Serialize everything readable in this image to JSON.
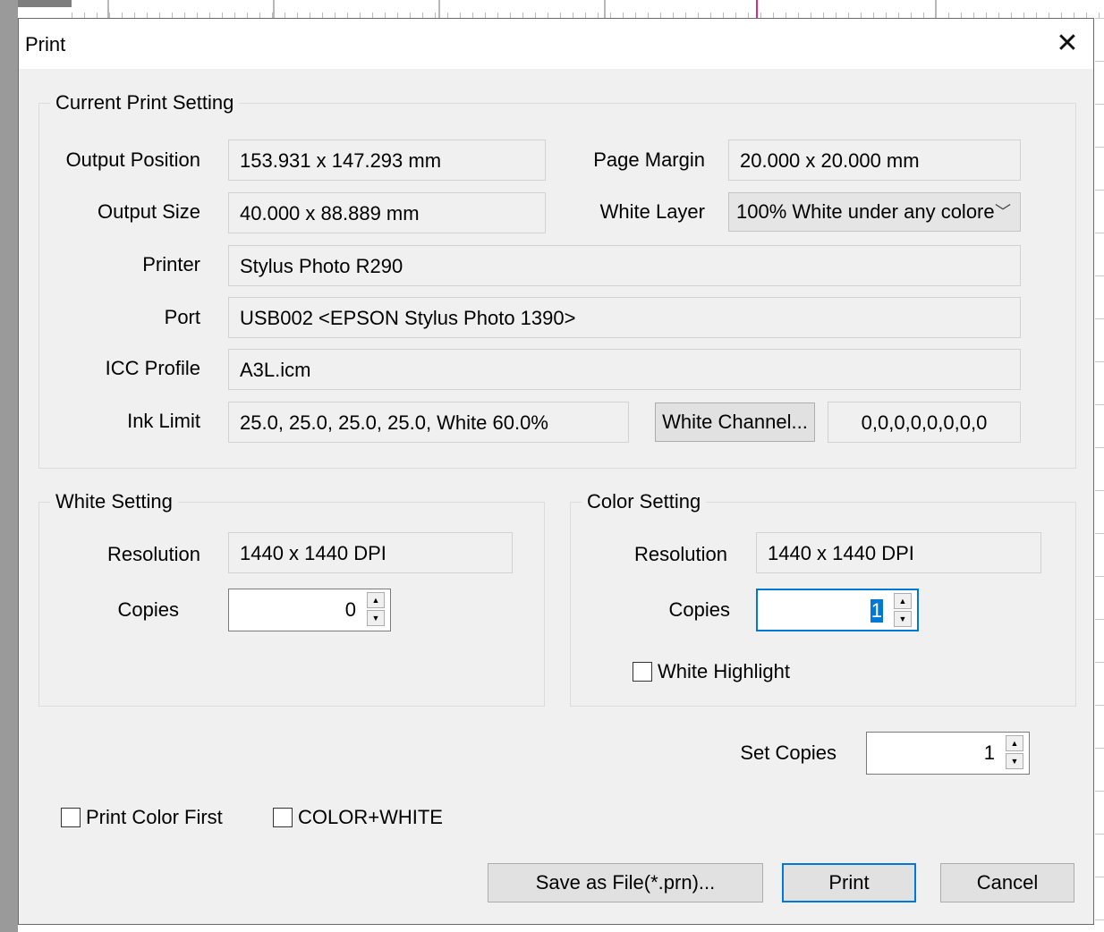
{
  "dialog": {
    "title": "Print",
    "close_symbol": "✕"
  },
  "current": {
    "legend": "Current Print Setting",
    "output_position_label": "Output Position",
    "output_position_value": "153.931 x 147.293 mm",
    "page_margin_label": "Page Margin",
    "page_margin_value": "20.000 x 20.000 mm",
    "output_size_label": "Output Size",
    "output_size_value": "40.000 x 88.889 mm",
    "white_layer_label": "White Layer",
    "white_layer_value": "100% White under any colore",
    "printer_label": "Printer",
    "printer_value": "Stylus Photo R290",
    "port_label": "Port",
    "port_value": "USB002  <EPSON Stylus Photo 1390>",
    "icc_label": "ICC Profile",
    "icc_value": "A3L.icm",
    "ink_limit_label": "Ink Limit",
    "ink_limit_value": "25.0, 25.0, 25.0, 25.0, White 60.0%",
    "white_channel_button": "White Channel...",
    "white_channel_value": "0,0,0,0,0,0,0,0"
  },
  "white_setting": {
    "legend": "White Setting",
    "resolution_label": "Resolution",
    "resolution_value": "1440 x 1440 DPI",
    "copies_label": "Copies",
    "copies_value": "0"
  },
  "color_setting": {
    "legend": "Color Setting",
    "resolution_label": "Resolution",
    "resolution_value": "1440 x 1440 DPI",
    "copies_label": "Copies",
    "copies_value": "1",
    "white_highlight_label": "White Highlight"
  },
  "set_copies": {
    "label": "Set Copies",
    "value": "1"
  },
  "options": {
    "print_color_first": "Print Color First",
    "color_white": "COLOR+WHITE"
  },
  "buttons": {
    "save_as_file": "Save as File(*.prn)...",
    "print": "Print",
    "cancel": "Cancel"
  },
  "icons": {
    "spin_up": "▲",
    "spin_down": "▼",
    "chevron": "﹀"
  },
  "colors": {
    "accent": "#0078d7",
    "dialog_bg": "#f0f0f0"
  }
}
